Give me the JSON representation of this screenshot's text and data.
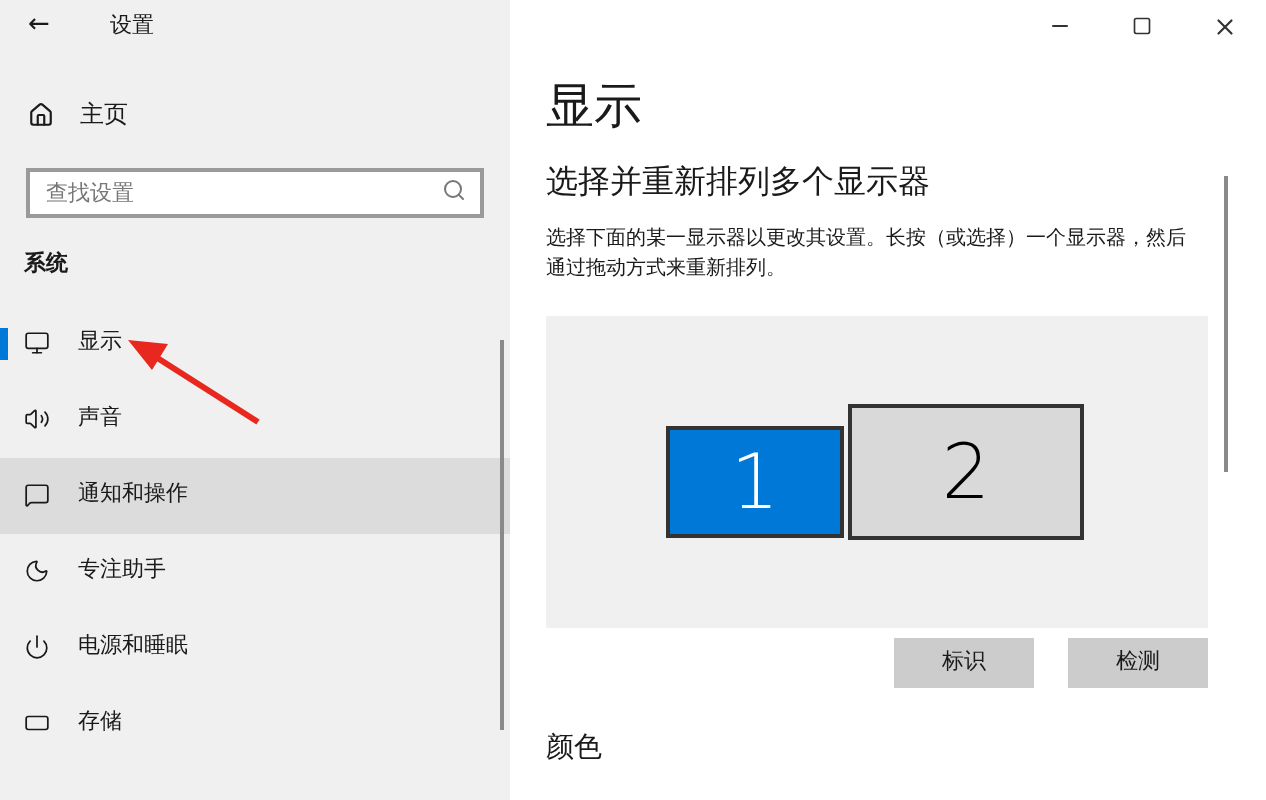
{
  "window": {
    "title": "设置",
    "back": "←"
  },
  "sidebar": {
    "home": "主页",
    "search": {
      "placeholder": "查找设置"
    },
    "section": "系统",
    "items": [
      {
        "label": "显示",
        "kind": "monitor",
        "selected": true,
        "hovered": false
      },
      {
        "label": "声音",
        "kind": "speaker",
        "selected": false,
        "hovered": false
      },
      {
        "label": "通知和操作",
        "kind": "message",
        "selected": false,
        "hovered": true
      },
      {
        "label": "专注助手",
        "kind": "moon",
        "selected": false,
        "hovered": false
      },
      {
        "label": "电源和睡眠",
        "kind": "power",
        "selected": false,
        "hovered": false
      },
      {
        "label": "存储",
        "kind": "storage",
        "selected": false,
        "hovered": false
      }
    ]
  },
  "main": {
    "title": "显示",
    "subtitle": "选择并重新排列多个显示器",
    "description": "选择下面的某一显示器以更改其设置。长按（或选择）一个显示器，然后通过拖动方式来重新排列。",
    "monitors": [
      {
        "label": "1",
        "selected": true
      },
      {
        "label": "2",
        "selected": false
      }
    ],
    "buttons": [
      "标识",
      "检测"
    ],
    "next_section": "颜色"
  }
}
